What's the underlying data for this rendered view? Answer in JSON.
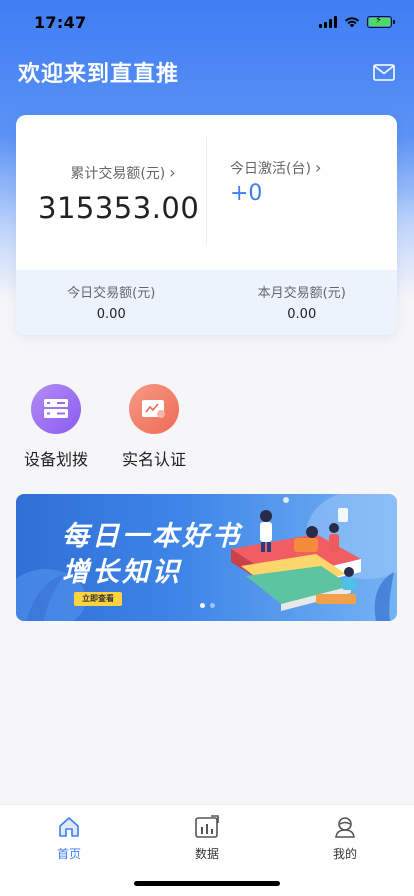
{
  "status_bar": {
    "time": "17:47"
  },
  "header": {
    "title": "欢迎来到直直推",
    "mail_icon": "mail-icon"
  },
  "stats": {
    "cumulative_label": "累计交易额(元)",
    "cumulative_value": "315353.00",
    "today_activation_label": "今日激活(台)",
    "today_activation_value": "+0",
    "today_trade_label": "今日交易额(元)",
    "today_trade_value": "0.00",
    "month_trade_label": "本月交易额(元)",
    "month_trade_value": "0.00"
  },
  "quick_actions": [
    {
      "label": "设备划拨",
      "icon": "device-card-icon",
      "color": "#9a6cf0"
    },
    {
      "label": "实名认证",
      "icon": "id-verify-icon",
      "color": "#f07864"
    }
  ],
  "banner": {
    "line1": "每日一本好书",
    "line2": "增长知识",
    "button": "立即查看",
    "slide_count": 2,
    "active_slide": 1
  },
  "tabbar": {
    "items": [
      {
        "label": "首页",
        "icon": "home-icon",
        "active": true
      },
      {
        "label": "数据",
        "icon": "chart-icon",
        "active": false
      },
      {
        "label": "我的",
        "icon": "profile-icon",
        "active": false
      }
    ]
  },
  "colors": {
    "accent": "#3f7df3",
    "header_bg": "#3f7df3",
    "banner_button": "#ffd33d"
  }
}
